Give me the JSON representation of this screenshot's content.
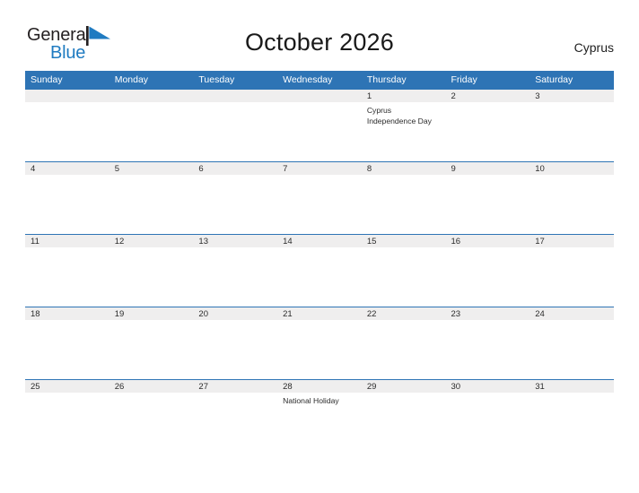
{
  "brand": {
    "name_part1": "General",
    "name_part2": "Blue",
    "flag_icon": "blue-flag-triangle",
    "accent_color": "#1f7bc1"
  },
  "header": {
    "title": "October 2026",
    "country": "Cyprus"
  },
  "colors": {
    "header_blue": "#2e74b5",
    "date_strip_gray": "#efeeee",
    "text_dark": "#2b2b2b"
  },
  "calendar": {
    "month": "October",
    "year": "2026",
    "weekday_headers": [
      "Sunday",
      "Monday",
      "Tuesday",
      "Wednesday",
      "Thursday",
      "Friday",
      "Saturday"
    ],
    "weeks": [
      [
        {
          "date": "",
          "events": []
        },
        {
          "date": "",
          "events": []
        },
        {
          "date": "",
          "events": []
        },
        {
          "date": "",
          "events": []
        },
        {
          "date": "1",
          "events": [
            "Cyprus",
            "Independence Day"
          ]
        },
        {
          "date": "2",
          "events": []
        },
        {
          "date": "3",
          "events": []
        }
      ],
      [
        {
          "date": "4",
          "events": []
        },
        {
          "date": "5",
          "events": []
        },
        {
          "date": "6",
          "events": []
        },
        {
          "date": "7",
          "events": []
        },
        {
          "date": "8",
          "events": []
        },
        {
          "date": "9",
          "events": []
        },
        {
          "date": "10",
          "events": []
        }
      ],
      [
        {
          "date": "11",
          "events": []
        },
        {
          "date": "12",
          "events": []
        },
        {
          "date": "13",
          "events": []
        },
        {
          "date": "14",
          "events": []
        },
        {
          "date": "15",
          "events": []
        },
        {
          "date": "16",
          "events": []
        },
        {
          "date": "17",
          "events": []
        }
      ],
      [
        {
          "date": "18",
          "events": []
        },
        {
          "date": "19",
          "events": []
        },
        {
          "date": "20",
          "events": []
        },
        {
          "date": "21",
          "events": []
        },
        {
          "date": "22",
          "events": []
        },
        {
          "date": "23",
          "events": []
        },
        {
          "date": "24",
          "events": []
        }
      ],
      [
        {
          "date": "25",
          "events": []
        },
        {
          "date": "26",
          "events": []
        },
        {
          "date": "27",
          "events": []
        },
        {
          "date": "28",
          "events": [
            "National Holiday"
          ]
        },
        {
          "date": "29",
          "events": []
        },
        {
          "date": "30",
          "events": []
        },
        {
          "date": "31",
          "events": []
        }
      ]
    ]
  }
}
